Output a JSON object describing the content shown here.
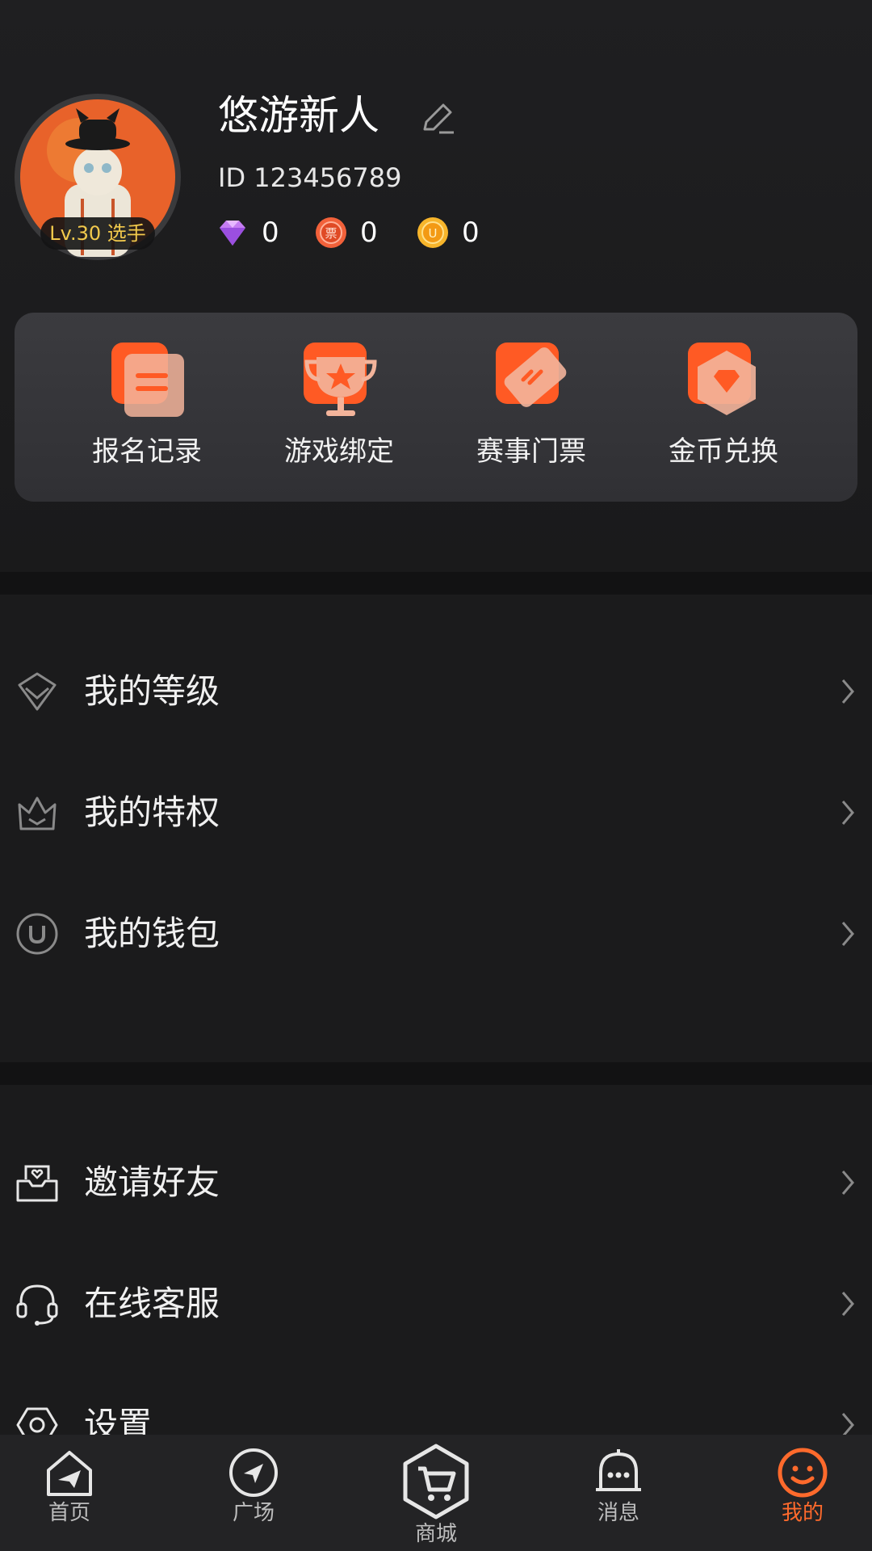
{
  "profile": {
    "username": "悠游新人",
    "id_text": "ID 123456789",
    "level_badge": "Lv.30 选手",
    "currencies": [
      {
        "icon": "diamond-icon",
        "value": "0"
      },
      {
        "icon": "ticket-coin-icon",
        "value": "0"
      },
      {
        "icon": "gold-coin-icon",
        "value": "0"
      }
    ]
  },
  "quick_actions": [
    {
      "label": "报名记录",
      "icon": "registration-record-icon"
    },
    {
      "label": "游戏绑定",
      "icon": "trophy-icon"
    },
    {
      "label": "赛事门票",
      "icon": "ticket-icon"
    },
    {
      "label": "金币兑换",
      "icon": "gem-exchange-icon"
    }
  ],
  "menu_group_1": [
    {
      "label": "我的等级",
      "icon": "level-icon"
    },
    {
      "label": "我的特权",
      "icon": "crown-icon"
    },
    {
      "label": "我的钱包",
      "icon": "wallet-coin-icon"
    }
  ],
  "menu_group_2": [
    {
      "label": "邀请好友",
      "icon": "invite-envelope-icon"
    },
    {
      "label": "在线客服",
      "icon": "headset-icon"
    },
    {
      "label": "设置",
      "icon": "settings-icon"
    }
  ],
  "bottom_nav": [
    {
      "label": "首页",
      "icon": "home-icon"
    },
    {
      "label": "广场",
      "icon": "compass-icon"
    },
    {
      "label": "商城",
      "icon": "shop-cart-icon"
    },
    {
      "label": "消息",
      "icon": "bell-icon"
    },
    {
      "label": "我的",
      "icon": "smile-icon",
      "active": true
    }
  ],
  "colors": {
    "accent": "#ff6a2c",
    "background": "#1b1b1c",
    "card": "#36363a",
    "level_text": "#f2c94c"
  }
}
